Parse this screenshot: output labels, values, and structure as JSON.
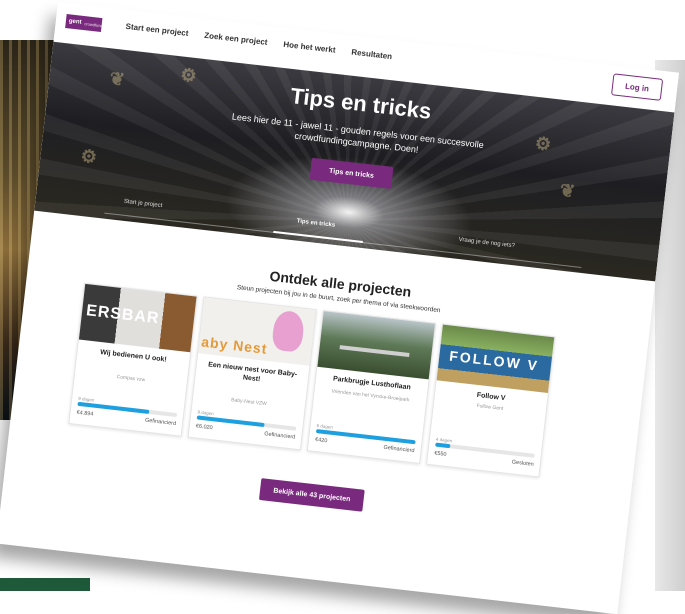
{
  "header": {
    "logo_text": "gent",
    "logo_sub": "crowdfunding",
    "nav": [
      "Start een project",
      "Zoek een project",
      "Hoe het werkt",
      "Resultaten"
    ],
    "login_label": "Log in"
  },
  "hero": {
    "title": "Tips en tricks",
    "subtitle": "Lees hier de 11 - jawel 11 - gouden regels voor een succesvolle crowdfundingcampagne. Doen!",
    "button_label": "Tips en tricks",
    "steps": [
      "Start je project",
      "Tips en tricks",
      "Vraag je de nog iets?"
    ]
  },
  "discover": {
    "title": "Ontdek alle projecten",
    "subtitle": "Steun projecten bij jou in de buurt, zoek per thema of via steekwoorden"
  },
  "projects": [
    {
      "image_text": "ERSBAR",
      "title": "Wij bedienen U ook!",
      "subtitle": "Compas vzw",
      "days": "9 dagen",
      "progress": 0.72,
      "amount": "€4.894",
      "status": "Gefinancierd"
    },
    {
      "image_text": "aby Nest",
      "title": "Een nieuw nest voor Baby-Nest!",
      "subtitle": "Baby-Nest VZW",
      "days": "9 dagen",
      "progress": 0.68,
      "amount": "€6.020",
      "status": "Gefinancierd"
    },
    {
      "image_text": "",
      "title": "Parkbrugje Lusthoflaan",
      "subtitle": "Vrienden van het Vyncke-Broeipark",
      "days": "6 dagen",
      "progress": 1.0,
      "amount": "€420",
      "status": "Gefinancierd"
    },
    {
      "image_text": "FOLLOW V",
      "title": "Follow V",
      "subtitle": "Follow Gent",
      "days": "4 dagen",
      "progress": 0.15,
      "amount": "€550",
      "status": "Gesloten"
    }
  ],
  "all_projects_label": "Bekijk alle 43 projecten",
  "colors": {
    "brand_purple": "#7a2a7e",
    "progress_blue": "#1ea0e0"
  }
}
